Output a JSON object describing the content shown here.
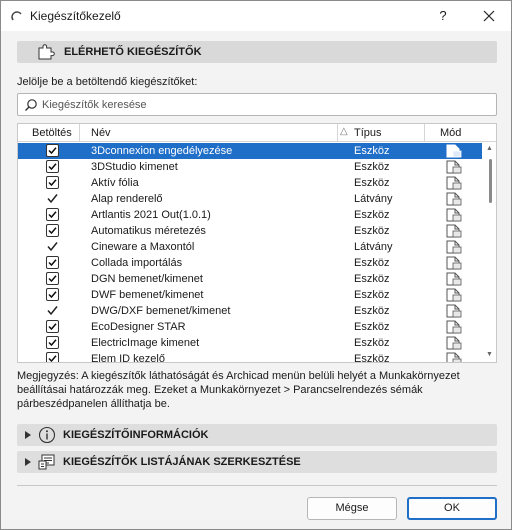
{
  "window": {
    "title": "Kiegészítőkezelő",
    "help_label": "?"
  },
  "available_section": {
    "title": "ELÉRHETŐ KIEGÉSZÍTŐK"
  },
  "instruction": "Jelölje be a betöltendő kiegészítőket:",
  "search": {
    "placeholder": "Kiegészítők keresése",
    "value": ""
  },
  "list": {
    "columns": {
      "load": "Betöltés",
      "name": "Név",
      "type": "Típus",
      "mod": "Mód"
    },
    "rows": [
      {
        "check": "box",
        "name": "3Dconnexion engedélyezése",
        "type": "Eszköz",
        "selected": true
      },
      {
        "check": "box",
        "name": "3DStudio kimenet",
        "type": "Eszköz",
        "selected": false
      },
      {
        "check": "box",
        "name": "Aktív fólia",
        "type": "Eszköz",
        "selected": false
      },
      {
        "check": "tick",
        "name": "Alap renderelő",
        "type": "Látvány",
        "selected": false
      },
      {
        "check": "box",
        "name": "Artlantis 2021 Out(1.0.1)",
        "type": "Eszköz",
        "selected": false
      },
      {
        "check": "box",
        "name": "Automatikus méretezés",
        "type": "Eszköz",
        "selected": false
      },
      {
        "check": "tick",
        "name": "Cineware a Maxontól",
        "type": "Látvány",
        "selected": false
      },
      {
        "check": "box",
        "name": "Collada importálás",
        "type": "Eszköz",
        "selected": false
      },
      {
        "check": "box",
        "name": "DGN bemenet/kimenet",
        "type": "Eszköz",
        "selected": false
      },
      {
        "check": "box",
        "name": "DWF bemenet/kimenet",
        "type": "Eszköz",
        "selected": false
      },
      {
        "check": "tick",
        "name": "DWG/DXF bemenet/kimenet",
        "type": "Eszköz",
        "selected": false
      },
      {
        "check": "box",
        "name": "EcoDesigner STAR",
        "type": "Eszköz",
        "selected": false
      },
      {
        "check": "box",
        "name": "ElectricImage kimenet",
        "type": "Eszköz",
        "selected": false
      },
      {
        "check": "box",
        "name": "Elem ID kezelő",
        "type": "Eszköz",
        "selected": false
      }
    ]
  },
  "note": "Megjegyzés: A kiegészítők láthatóságát és Archicad menün belüli helyét a Munkakörnyezet beállításai határozzák meg. Ezeket a Munkakörnyezet > Parancselrendezés sémák párbeszédpanelen állíthatja be.",
  "info_section": {
    "title": "KIEGÉSZÍTŐINFORMÁCIÓK"
  },
  "edit_section": {
    "title": "KIEGÉSZÍTŐK LISTÁJÁNAK SZERKESZTÉSE"
  },
  "buttons": {
    "cancel": "Mégse",
    "ok": "OK"
  },
  "colors": {
    "selection": "#1f6ec8",
    "section_bg": "#d9d9d9"
  }
}
